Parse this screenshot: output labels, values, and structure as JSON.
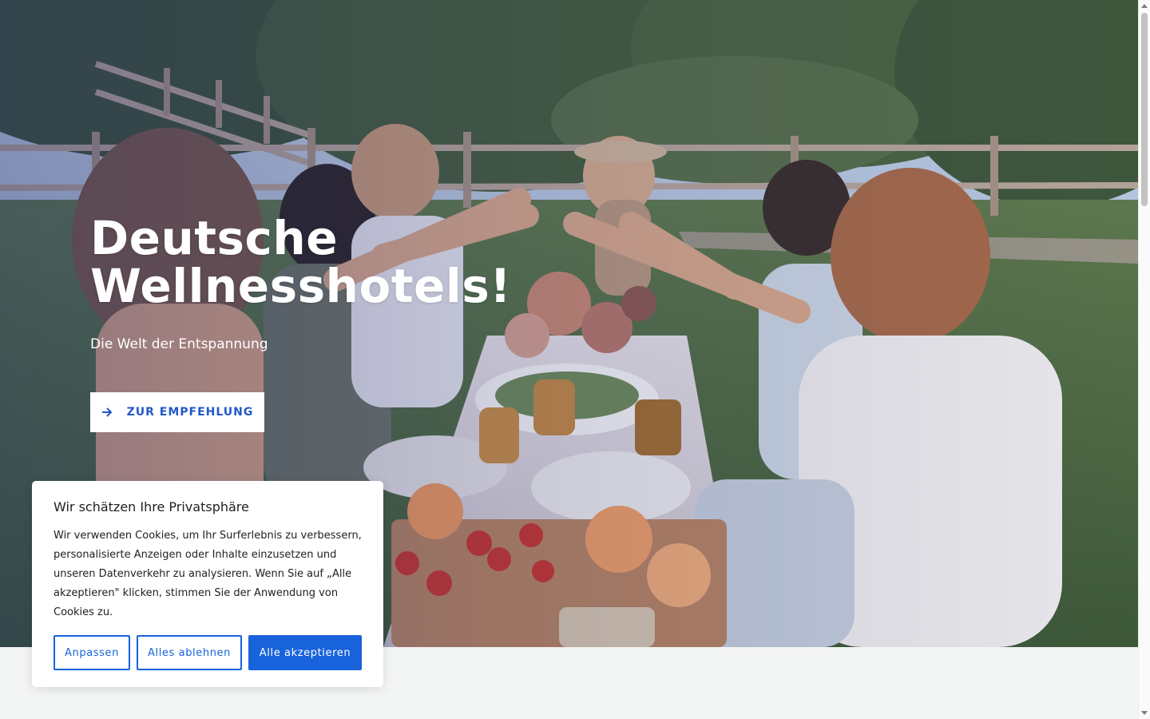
{
  "hero": {
    "title_line1": "Deutsche",
    "title_line2": "Wellnesshotels!",
    "subtitle": "Die Welt der Entspannung",
    "cta_label": "ZUR EMPFEHLUNG",
    "cta_icon": "arrow-right-icon"
  },
  "cookie_banner": {
    "title": "Wir schätzen Ihre Privatsphäre",
    "text": "Wir verwenden Cookies, um Ihr Surferlebnis zu verbessern, personalisierte Anzeigen oder Inhalte einzusetzen und unseren Datenverkehr zu analysieren. Wenn Sie auf „Alle akzeptieren\" klicken, stimmen Sie der Anwendung von Cookies zu.",
    "customize_label": "Anpassen",
    "reject_label": "Alles ablehnen",
    "accept_label": "Alle akzeptieren"
  },
  "colors": {
    "accent": "#1863dc",
    "cta_text": "#2358c9",
    "page_background": "#f3f4f4"
  }
}
